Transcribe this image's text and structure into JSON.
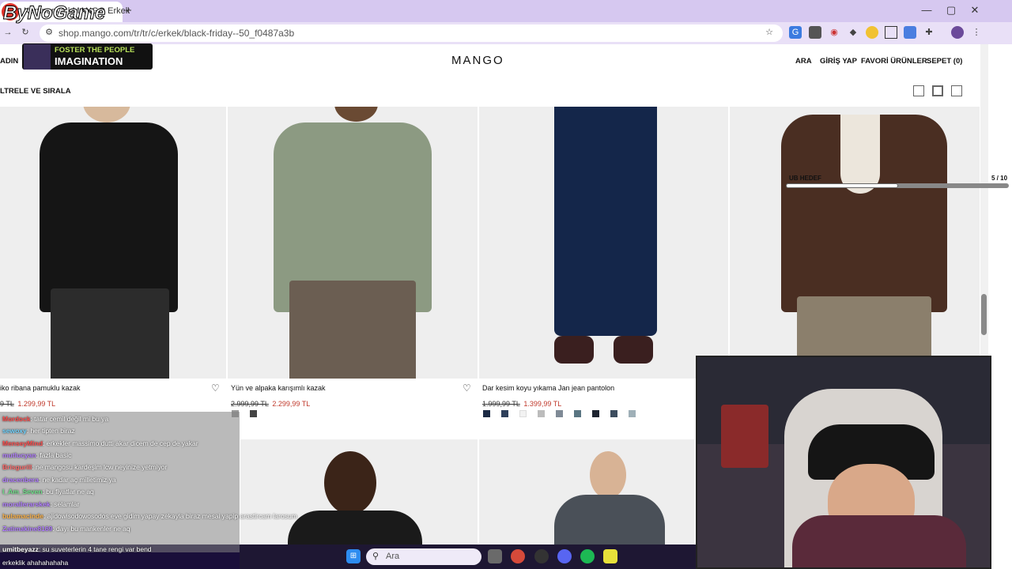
{
  "browser": {
    "tab_title": "Kampanya | MANGO Erkek",
    "new_tab": "+",
    "url": "shop.mango.com/tr/tr/c/erkek/black-friday--50_f0487a3b",
    "win_min": "—",
    "win_max": "▢",
    "win_close": "✕"
  },
  "stream_brand": "ByNoGame",
  "now_playing": {
    "artist": "FOSTER THE PEOPLE",
    "song": "IMAGINATION"
  },
  "header": {
    "left_link": "ADIN",
    "logo": "MANGO",
    "nav": [
      "ARA",
      "GİRİŞ YAP",
      "FAVORİ ÜRÜNLER",
      "SEPET (0)"
    ]
  },
  "filter_label": "LTRELE VE SIRALA",
  "products": [
    {
      "name": "iko ribana pamuklu kazak",
      "old_price": "9 TL",
      "new_price": "1.299,99 TL",
      "swatches": [
        "#1a1a1a",
        "#444444"
      ]
    },
    {
      "name": "Yün ve alpaka karışımlı kazak",
      "old_price": "2.999,99 TL",
      "new_price": "2.299,99 TL",
      "swatches": [
        "#9a9a9a",
        "#444444"
      ]
    },
    {
      "name": "Dar kesim koyu yıkama Jan jean pantolon",
      "old_price": "1.999,99 TL",
      "new_price": "1.399,99 TL",
      "swatches": [
        "#1c2a44",
        "#2e3f5a",
        "#f2f2f2",
        "#bcbcbc",
        "#7f8a96",
        "#5a7582",
        "#1e2430",
        "#3c4d5e",
        "#9fb0b8"
      ]
    },
    {
      "name": "",
      "old_price": "",
      "new_price": "",
      "swatches": []
    }
  ],
  "goal": {
    "label": "UB HEDEF",
    "count": "5 / 10",
    "progress": 0.5
  },
  "chat": [
    {
      "user": "Mordock",
      "text": ": tatar cemil değil mi bu ya",
      "color": "#ff4d4d"
    },
    {
      "user": "sewoxy",
      "text": ": her tipten biraz",
      "color": "#6fd3ff"
    },
    {
      "user": "MenseyMind",
      "text": ": erkekler massimo dutti akar dicem de cep de yakar",
      "color": "#ff4d4d"
    },
    {
      "user": "mutlucyan",
      "text": ": fazla basic",
      "color": "#b07cff"
    },
    {
      "user": "Brisgurill",
      "text": ": ne mangosu kardeşim lcw neyinize yetmiyor",
      "color": "#ff6a6a"
    },
    {
      "user": "dracenbera",
      "text": ": ne kadar aç milletimiz ya",
      "color": "#b07cff"
    },
    {
      "user": "I_Am_Seven",
      "text": ": bu fiyatlar ne aq",
      "color": "#6fe38a"
    },
    {
      "user": "morallerarskek",
      "text": ": selamlar",
      "color": "#b07cff"
    },
    {
      "user": "bulamacinde",
      "text": ": ajidowisodowosodos eve gidim yapay zekayla biraz mesai yapip arastircam larosum",
      "color": "#ffb347"
    },
    {
      "user": "Zatimakine8169",
      "text": ": dayı bu mankenler ne aq",
      "color": "#b07cff"
    },
    {
      "user": "umitbeyazz",
      "text": ": su suveterlerin 4 tane rengi var bend",
      "color": "#ffffff"
    },
    {
      "user": "",
      "text": "erkeklik ahahahahaha",
      "color": "#ffffff"
    }
  ],
  "taskbar": {
    "search_placeholder": "Ara"
  },
  "colors": {
    "accent_price": "#c0392b",
    "chrome_bg": "#d6c8f0",
    "taskbar": "#1e1733"
  }
}
